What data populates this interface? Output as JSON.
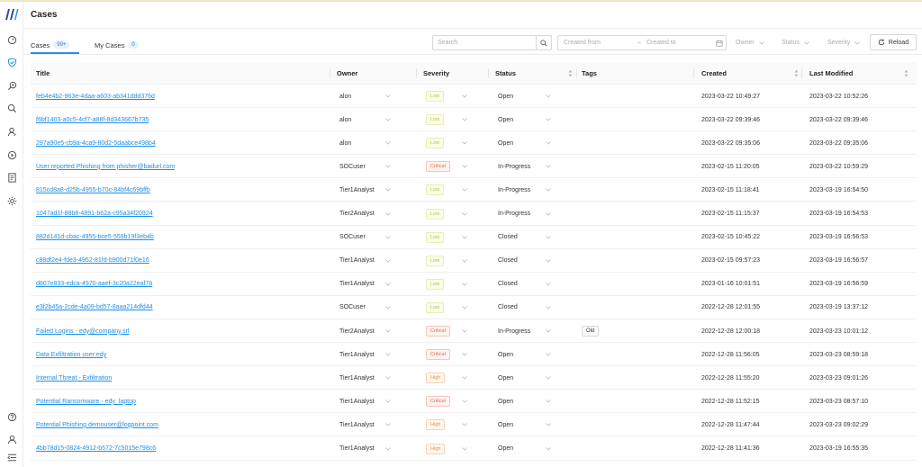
{
  "page": {
    "title": "Cases"
  },
  "sidebar": {
    "logo": "brand-logo",
    "items": [
      {
        "icon": "dashboard-icon"
      },
      {
        "icon": "shield-check-icon",
        "active": true
      },
      {
        "icon": "search-zoom-icon"
      },
      {
        "icon": "search-icon"
      },
      {
        "icon": "user-icon"
      },
      {
        "icon": "play-circle-icon"
      },
      {
        "icon": "report-icon"
      },
      {
        "icon": "settings-icon"
      }
    ],
    "bottom_items": [
      {
        "icon": "help-icon"
      },
      {
        "icon": "profile-icon"
      },
      {
        "icon": "menu-collapse-icon"
      }
    ]
  },
  "tabs": [
    {
      "label": "Cases",
      "badge": "99+",
      "active": true
    },
    {
      "label": "My Cases",
      "badge": "0",
      "active": false
    }
  ],
  "toolbar": {
    "search_placeholder": "Search",
    "created_from": "Created from",
    "created_to": "Created to",
    "owner_filter": "Owner",
    "status_filter": "Status",
    "severity_filter": "Severity",
    "reload_label": "Reload"
  },
  "colors": {
    "accent": "#1f8ee8",
    "low": "#b4c24c",
    "critical": "#e26a4f",
    "high": "#e8914a"
  },
  "table": {
    "columns": {
      "title": "Title",
      "owner": "Owner",
      "severity": "Severity",
      "status": "Status",
      "tags": "Tags",
      "created": "Created",
      "modified": "Last Modified"
    },
    "rows": [
      {
        "title": "feb4e4b2-963e-4daa-a603-ab341ddd376d",
        "owner": "alon",
        "severity": "Low",
        "sev_class": "low",
        "status": "Open",
        "tag": "",
        "created": "2023-03-22 10:49:27",
        "modified": "2023-03-22 10:52:26"
      },
      {
        "title": "f6bf1403-a0c5-4cf7-a88f-8d343667b735",
        "owner": "alon",
        "severity": "Low",
        "sev_class": "low",
        "status": "Open",
        "tag": "",
        "created": "2023-03-22 09:39:46",
        "modified": "2023-03-22 09:39:46"
      },
      {
        "title": "297a90e5-cb9a-4ca9-80d2-5daabce498b4",
        "owner": "alon",
        "severity": "Low",
        "sev_class": "low",
        "status": "Open",
        "tag": "",
        "created": "2023-03-22 09:35:06",
        "modified": "2023-03-22 09:35:06"
      },
      {
        "title": "User reported Phishing from phisher@badurl.com",
        "owner": "SOCuser",
        "severity": "Critical",
        "sev_class": "critical",
        "status": "In-Progress",
        "tag": "",
        "created": "2023-02-15 11:20:05",
        "modified": "2023-03-22 10:59:29"
      },
      {
        "title": "815cd8a8-d25b-4955-b70c-84bf4c69bffb",
        "owner": "Tier1Analyst",
        "severity": "Low",
        "sev_class": "low",
        "status": "In-Progress",
        "tag": "",
        "created": "2023-02-15 11:18:41",
        "modified": "2023-03-19 16:54:50"
      },
      {
        "title": "1047ad1f-88b8-4891-b62a-c95a34f20924",
        "owner": "Tier2Analyst",
        "severity": "Low",
        "sev_class": "low",
        "status": "In-Progress",
        "tag": "",
        "created": "2023-02-15 11:15:37",
        "modified": "2023-03-19 16:54:53"
      },
      {
        "title": "882d141d-cbac-4955-bce5-559b19f3eb4b",
        "owner": "SOCuser",
        "severity": "Low",
        "sev_class": "low",
        "status": "Closed",
        "tag": "",
        "created": "2023-02-15 10:45:22",
        "modified": "2023-03-19 16:56:53"
      },
      {
        "title": "c88df2e4-fde3-4952-81fd-b900d71f0e16",
        "owner": "Tier1Analyst",
        "severity": "Low",
        "sev_class": "low",
        "status": "Closed",
        "tag": "",
        "created": "2023-02-15 09:57:23",
        "modified": "2023-03-19 16:56:57"
      },
      {
        "title": "d807e833-edca-4970-aaef-3c20a22eaf7b",
        "owner": "Tier1Analyst",
        "severity": "Low",
        "sev_class": "low",
        "status": "Closed",
        "tag": "",
        "created": "2023-01-16 10:01:51",
        "modified": "2023-03-19 16:56:59"
      },
      {
        "title": "e3f2b45a-2cde-4a09-bd57-8aaa214dfd44",
        "owner": "SOCuser",
        "severity": "Low",
        "sev_class": "low",
        "status": "Closed",
        "tag": "",
        "created": "2022-12-28 12:01:55",
        "modified": "2023-03-19 13:37:12"
      },
      {
        "title": "Failed Logins - edy@company.srl",
        "owner": "Tier2Analyst",
        "severity": "Critical",
        "sev_class": "critical",
        "status": "In-Progress",
        "tag": "Old",
        "created": "2022-12-28 12:00:18",
        "modified": "2023-03-23 10:01:12"
      },
      {
        "title": "Data Exfiltration user:edy",
        "owner": "Tier1Analyst",
        "severity": "Critical",
        "sev_class": "critical",
        "status": "Open",
        "tag": "",
        "created": "2022-12-28 11:56:05",
        "modified": "2023-03-23 08:59:18"
      },
      {
        "title": "Internal Threat - Exfiltration",
        "owner": "Tier1Analyst",
        "severity": "High",
        "sev_class": "high",
        "status": "Open",
        "tag": "",
        "created": "2022-12-28 11:55:20",
        "modified": "2023-03-23 09:01:26"
      },
      {
        "title": "Potential Ransomware - edy_laptop",
        "owner": "Tier1Analyst",
        "severity": "Critical",
        "sev_class": "critical",
        "status": "Open",
        "tag": "",
        "created": "2022-12-28 11:52:15",
        "modified": "2023-03-23 08:57:10"
      },
      {
        "title": "Potential Phishing demouser@logpoint.com",
        "owner": "Tier1Analyst",
        "severity": "High",
        "sev_class": "high",
        "status": "Open",
        "tag": "",
        "created": "2022-12-28 11:47:44",
        "modified": "2023-03-23 09:02:29"
      },
      {
        "title": "4bb78d15-0824-4912-b572-7c5015e798c6",
        "owner": "Tier1Analyst",
        "severity": "High",
        "sev_class": "high",
        "status": "Open",
        "tag": "",
        "created": "2022-12-28 11:41:36",
        "modified": "2023-03-19 16:55:35"
      }
    ]
  }
}
